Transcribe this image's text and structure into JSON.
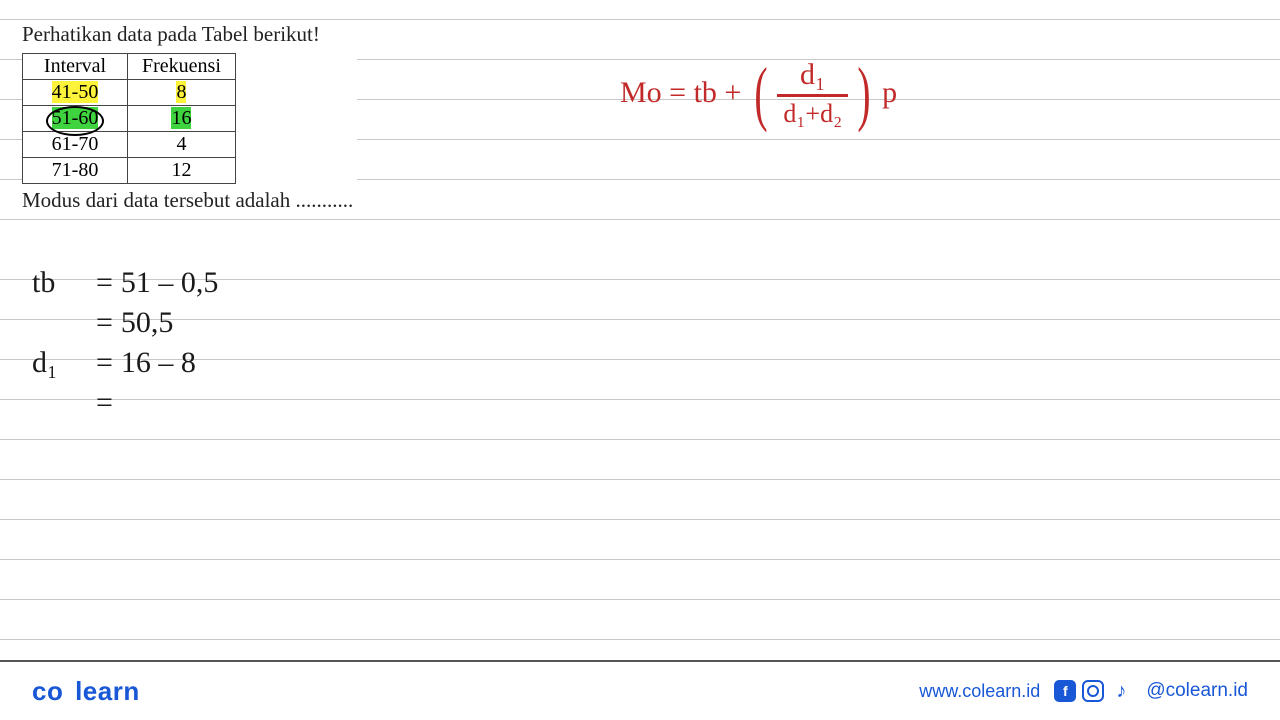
{
  "question": {
    "title": "Perhatikan data pada Tabel berikut!",
    "followup": "Modus dari data tersebut adalah ..........."
  },
  "table": {
    "headers": {
      "c1": "Interval",
      "c2": "Frekuensi"
    },
    "rows": [
      {
        "interval": "41-50",
        "freq": "8"
      },
      {
        "interval": "51-60",
        "freq": "16"
      },
      {
        "interval": "61-70",
        "freq": "4"
      },
      {
        "interval": "71-80",
        "freq": "12"
      }
    ]
  },
  "formula": {
    "lhs": "Mo = tb +",
    "num": "d₁",
    "den": "d₁+d₂",
    "tail": "p"
  },
  "work": {
    "l1_sym": "tb",
    "l1_eq": "=",
    "l1_val": "51 – 0,5",
    "l2_eq": "=",
    "l2_val": "50,5",
    "l3_sym": "d₁",
    "l3_eq": "=",
    "l3_val": "16 – 8",
    "l4_eq": "="
  },
  "footer": {
    "brand_a": "co",
    "brand_b": "learn",
    "url": "www.colearn.id",
    "fb": "f",
    "tk": "♪",
    "handle": "@colearn.id"
  }
}
